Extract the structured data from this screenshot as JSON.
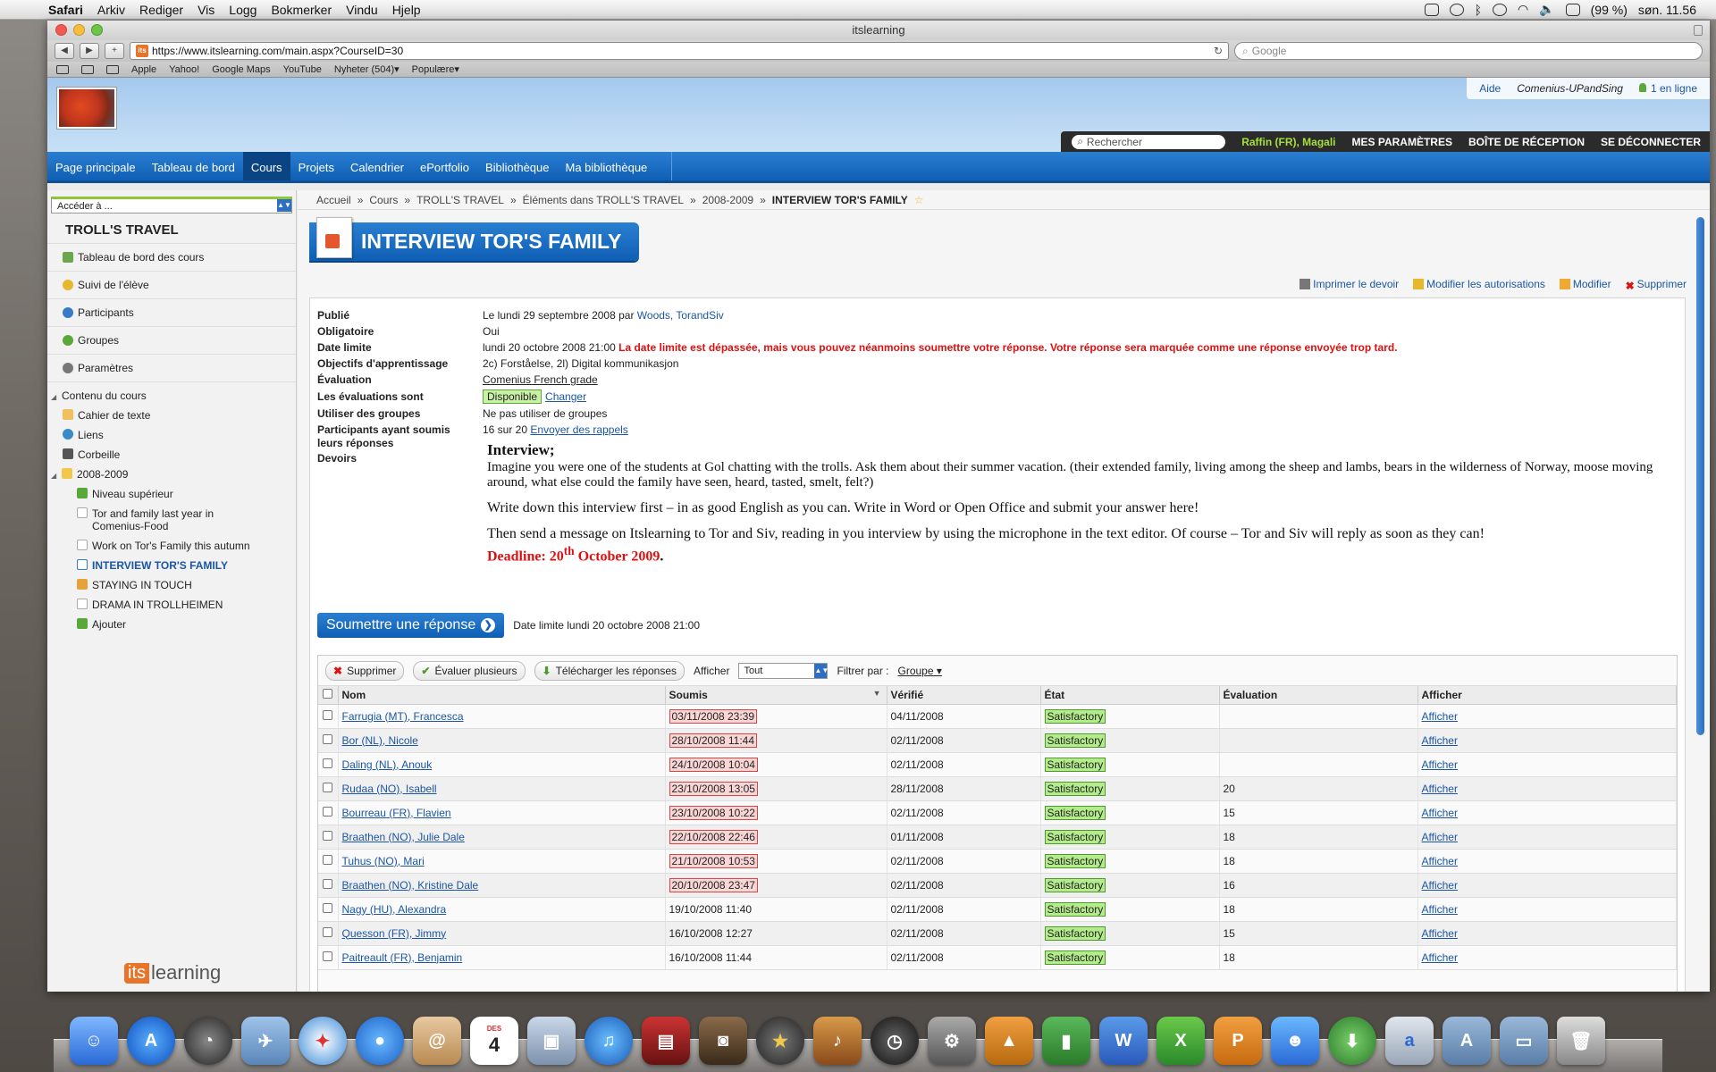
{
  "menubar": {
    "app": "Safari",
    "items": [
      "Arkiv",
      "Rediger",
      "Vis",
      "Logg",
      "Bokmerker",
      "Vindu",
      "Hjelp"
    ],
    "battery": "(99 %)",
    "clock": "søn. 11.56"
  },
  "browser": {
    "window_title": "itslearning",
    "url": "https://www.itslearning.com/main.aspx?CourseID=30",
    "search_placeholder": "Google",
    "bookmarks": [
      "Apple",
      "Yahoo!",
      "Google Maps",
      "YouTube",
      "Nyheter (504)▾",
      "Populære▾"
    ]
  },
  "header": {
    "help": "Aide",
    "site": "Comenius-UPandSing",
    "online": "1 en ligne",
    "search_placeholder": "Rechercher",
    "user": "Raffin (FR), Magali",
    "settings": "MES PARAMÈTRES",
    "inbox": "BOÎTE DE RÉCEPTION",
    "logout": "SE DÉCONNECTER"
  },
  "nav": {
    "tabs": [
      "Page principale",
      "Tableau de bord",
      "Cours",
      "Projets",
      "Calendrier",
      "ePortfolio",
      "Bibliothèque",
      "Ma bibliothèque"
    ],
    "active": "Cours"
  },
  "sidebar": {
    "goto": "Accéder à ...",
    "course": "TROLL'S TRAVEL",
    "items": [
      "Tableau de bord des cours",
      "Suivi de l'élève",
      "Participants",
      "Groupes",
      "Paramètres"
    ],
    "content_header": "Contenu du cours",
    "tree": [
      "Cahier de texte",
      "Liens",
      "Corbeille",
      "2008-2009",
      "Niveau supérieur",
      "Tor and family last year in Comenius-Food",
      "Work on Tor's Family this autumn",
      "INTERVIEW TOR'S FAMILY",
      "STAYING IN TOUCH",
      "DRAMA IN TROLLHEIMEN",
      "Ajouter"
    ],
    "logo_its": "its",
    "logo_rest": "learning"
  },
  "breadcrumb": [
    "Accueil",
    "Cours",
    "TROLL'S TRAVEL",
    "Éléments dans TROLL'S TRAVEL",
    "2008-2009",
    "INTERVIEW TOR'S FAMILY"
  ],
  "page": {
    "title": "INTERVIEW TOR'S FAMILY",
    "actions": [
      "Imprimer le devoir",
      "Modifier les autorisations",
      "Modifier",
      "Supprimer"
    ]
  },
  "props": {
    "published_label": "Publié",
    "published_value": "Le lundi 29 septembre 2008 par",
    "published_by": "Woods, TorandSiv",
    "mandatory_label": "Obligatoire",
    "mandatory_value": "Oui",
    "deadline_label": "Date limite",
    "deadline_value": "lundi 20 octobre 2008 21:00",
    "deadline_warning": "La date limite est dépassée, mais vous pouvez néanmoins soumettre votre réponse. Votre réponse sera marquée comme une réponse envoyée trop tard.",
    "objectives_label": "Objectifs d'apprentissage",
    "objectives_value": "2c) Forståelse, 2l) Digital kommunikasjon",
    "evaluation_label": "Évaluation",
    "evaluation_value": "Comenius French grade",
    "evals_label": "Les évaluations sont",
    "evals_status": "Disponible",
    "evals_change": "Changer",
    "groups_label": "Utiliser des groupes",
    "groups_value": "Ne pas utiliser de groupes",
    "submitted_label_1": "Participants ayant soumis",
    "submitted_label_2": "leurs réponses",
    "submitted_value": "16 sur 20",
    "reminders": "Envoyer des rappels",
    "duty_label": "Devoirs"
  },
  "assignment": {
    "heading": "Interview;",
    "p1": "Imagine you were one of the students at Gol chatting with the trolls. Ask them about their summer vacation. (their extended family, living among the sheep and lambs, bears in the wilderness of Norway, moose moving around, what else could the family have seen, heard, tasted, smelt, felt?)",
    "p2": "Write down this interview first – in as good English as you can. Write in Word or Open Office and submit your answer here!",
    "p3": "Then send a message on Itslearning to Tor and Siv, reading in you interview by using the microphone in the text editor. Of course – Tor and Siv will reply as soon as they can!",
    "deadline_a": "Deadline: 20",
    "deadline_sup": "th",
    "deadline_b": " October 2009",
    "deadline_dot": "."
  },
  "submit": {
    "button": "Soumettre une réponse",
    "deadline_note": "Date limite lundi 20 octobre 2008 21:00"
  },
  "toolbar": {
    "delete": "Supprimer",
    "evaluate": "Évaluer plusieurs",
    "download": "Télécharger les réponses",
    "show_label": "Afficher",
    "show_value": "Tout",
    "filter_label": "Filtrer par :",
    "filter_value": "Groupe"
  },
  "table": {
    "headers": [
      "Nom",
      "Soumis",
      "Vérifié",
      "État",
      "Évaluation",
      "Afficher"
    ],
    "rows": [
      {
        "name": "Farrugia (MT), Francesca",
        "submitted": "03/11/2008 23:39",
        "late": true,
        "verified": "04/11/2008",
        "state": "Satisfactory",
        "grade": "",
        "view": "Afficher"
      },
      {
        "name": "Bor (NL), Nicole",
        "submitted": "28/10/2008 11:44",
        "late": true,
        "verified": "02/11/2008",
        "state": "Satisfactory",
        "grade": "",
        "view": "Afficher"
      },
      {
        "name": "Daling (NL), Anouk",
        "submitted": "24/10/2008 10:04",
        "late": true,
        "verified": "02/11/2008",
        "state": "Satisfactory",
        "grade": "",
        "view": "Afficher"
      },
      {
        "name": "Rudaa (NO), Isabell",
        "submitted": "23/10/2008 13:05",
        "late": true,
        "verified": "28/11/2008",
        "state": "Satisfactory",
        "grade": "20",
        "view": "Afficher"
      },
      {
        "name": "Bourreau (FR), Flavien",
        "submitted": "23/10/2008 10:22",
        "late": true,
        "verified": "02/11/2008",
        "state": "Satisfactory",
        "grade": "15",
        "view": "Afficher"
      },
      {
        "name": "Braathen (NO), Julie Dale",
        "submitted": "22/10/2008 22:46",
        "late": true,
        "verified": "01/11/2008",
        "state": "Satisfactory",
        "grade": "18",
        "view": "Afficher"
      },
      {
        "name": "Tuhus (NO), Mari",
        "submitted": "21/10/2008 10:53",
        "late": true,
        "verified": "02/11/2008",
        "state": "Satisfactory",
        "grade": "18",
        "view": "Afficher"
      },
      {
        "name": "Braathen (NO), Kristine Dale",
        "submitted": "20/10/2008 23:47",
        "late": true,
        "verified": "02/11/2008",
        "state": "Satisfactory",
        "grade": "16",
        "view": "Afficher"
      },
      {
        "name": "Nagy (HU), Alexandra",
        "submitted": "19/10/2008 11:40",
        "late": false,
        "verified": "02/11/2008",
        "state": "Satisfactory",
        "grade": "18",
        "view": "Afficher"
      },
      {
        "name": "Quesson (FR), Jimmy",
        "submitted": "16/10/2008 12:27",
        "late": false,
        "verified": "02/11/2008",
        "state": "Satisfactory",
        "grade": "15",
        "view": "Afficher"
      },
      {
        "name": "Paitreault (FR), Benjamin",
        "submitted": "16/10/2008 11:44",
        "late": false,
        "verified": "02/11/2008",
        "state": "Satisfactory",
        "grade": "18",
        "view": "Afficher"
      }
    ]
  },
  "dock": {
    "calendar_month": "DES",
    "calendar_day": "4"
  },
  "colors": {
    "accent_blue": "#0f5fb4",
    "late_red": "#d44",
    "satisfactory_green": "#b4ec8c"
  }
}
